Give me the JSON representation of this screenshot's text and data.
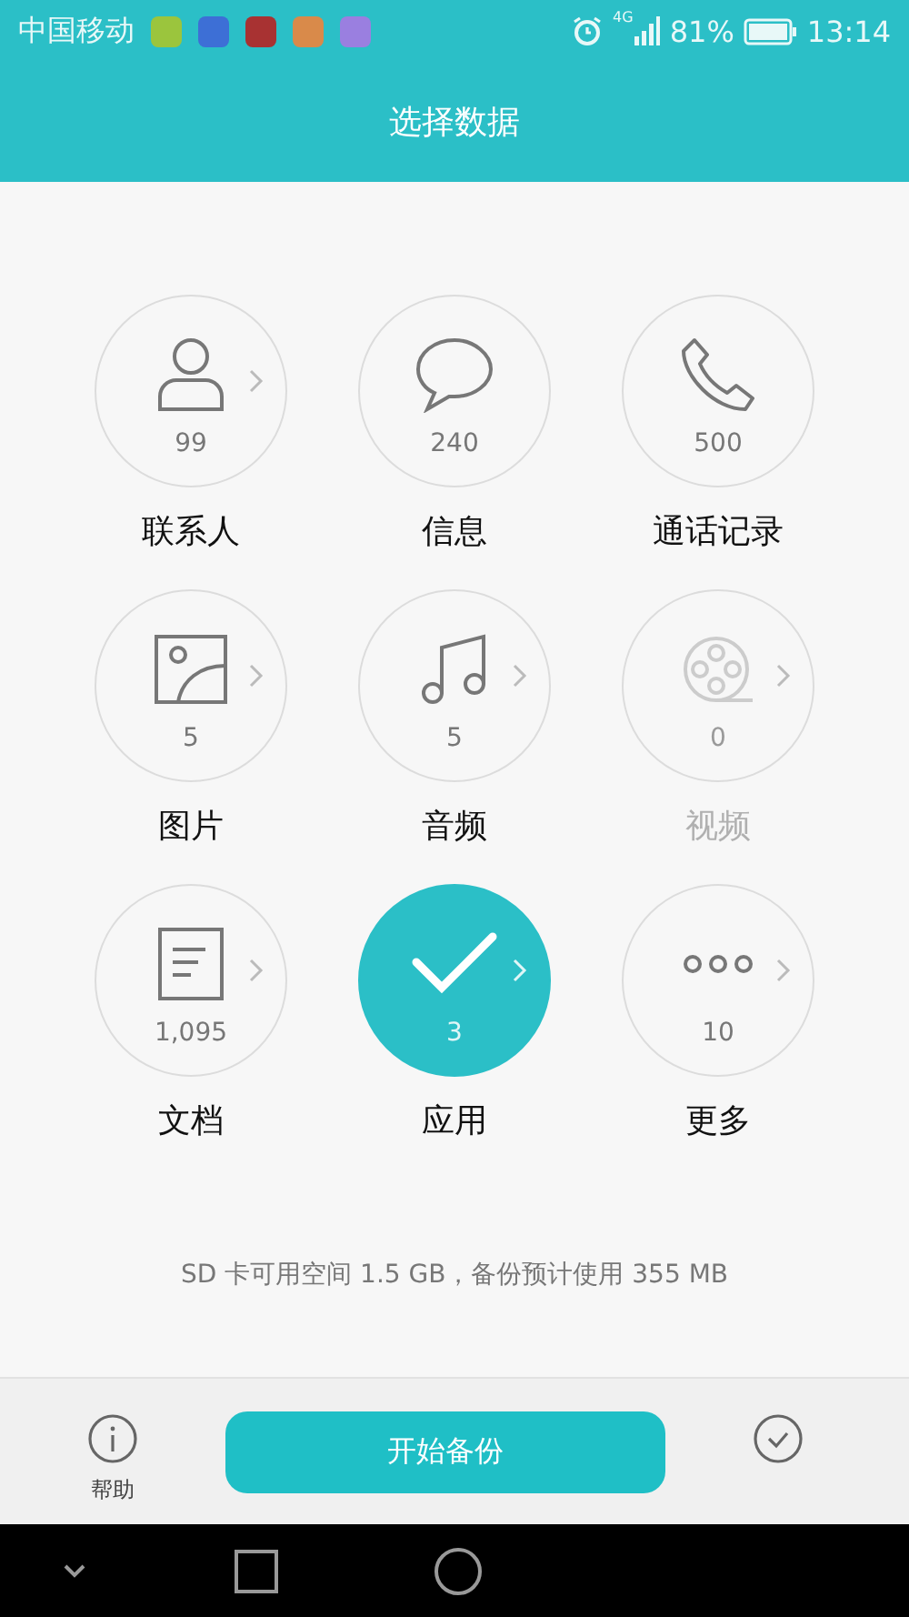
{
  "status_bar": {
    "carrier": "中国移动",
    "network": "4G",
    "battery": "81%",
    "time": "13:14"
  },
  "header": {
    "title": "选择数据"
  },
  "categories": [
    {
      "kind": "contacts",
      "count": "99",
      "label": "联系人",
      "selected": false,
      "disabled": false,
      "arrow": true
    },
    {
      "kind": "messages",
      "count": "240",
      "label": "信息",
      "selected": false,
      "disabled": false,
      "arrow": false
    },
    {
      "kind": "calls",
      "count": "500",
      "label": "通话记录",
      "selected": false,
      "disabled": false,
      "arrow": false
    },
    {
      "kind": "pictures",
      "count": "5",
      "label": "图片",
      "selected": false,
      "disabled": false,
      "arrow": true
    },
    {
      "kind": "audio",
      "count": "5",
      "label": "音频",
      "selected": false,
      "disabled": false,
      "arrow": true
    },
    {
      "kind": "video",
      "count": "0",
      "label": "视频",
      "selected": false,
      "disabled": true,
      "arrow": true
    },
    {
      "kind": "documents",
      "count": "1,095",
      "label": "文档",
      "selected": false,
      "disabled": false,
      "arrow": true
    },
    {
      "kind": "apps",
      "count": "3",
      "label": "应用",
      "selected": true,
      "disabled": false,
      "arrow": true
    },
    {
      "kind": "more",
      "count": "10",
      "label": "更多",
      "selected": false,
      "disabled": false,
      "arrow": true
    }
  ],
  "storage_info": "SD 卡可用空间 1.5 GB，备份预计使用 355 MB",
  "bottom_bar": {
    "help": "帮助",
    "start_button": "开始备份"
  }
}
